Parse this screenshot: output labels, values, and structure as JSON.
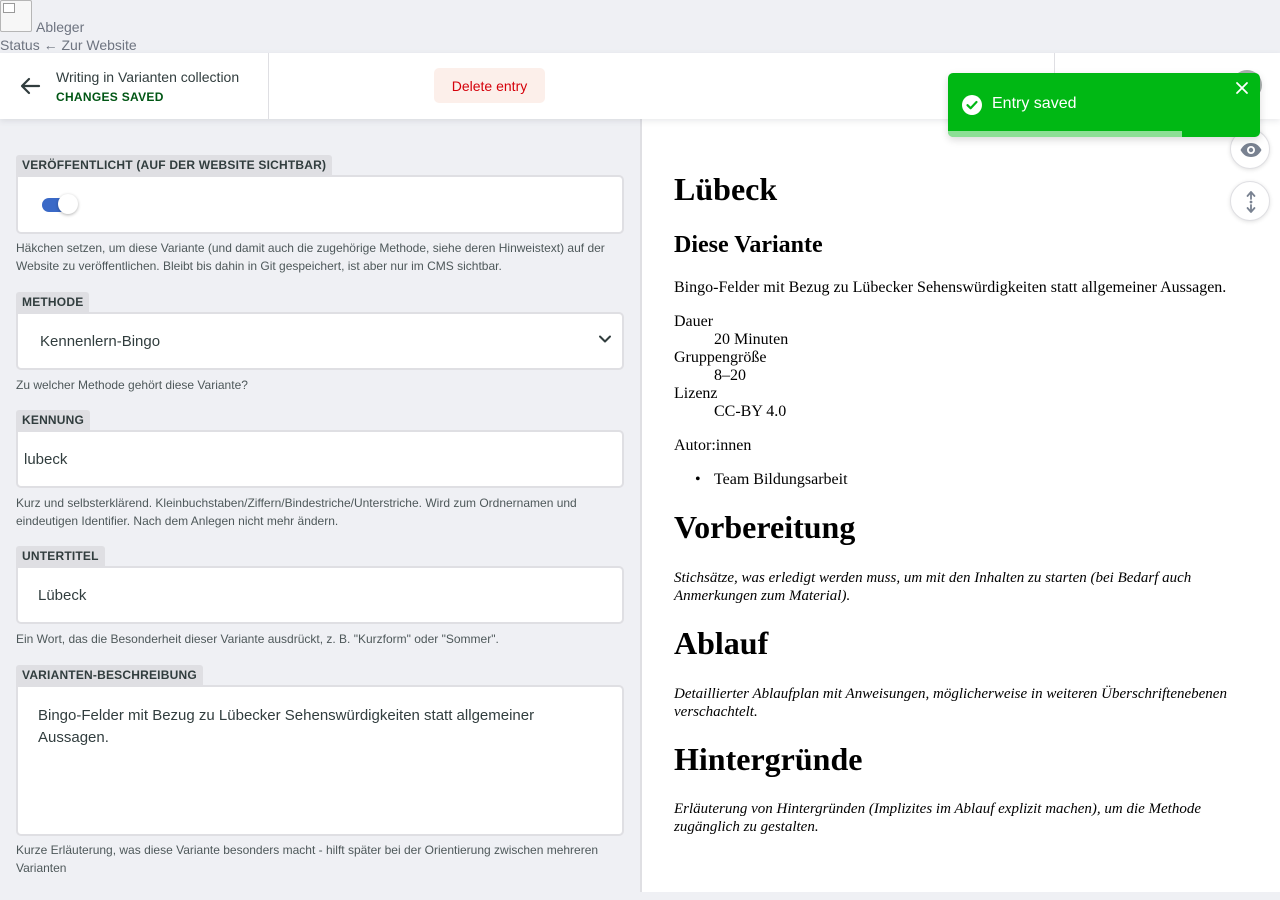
{
  "site": {
    "name": "Ableger",
    "status_label": "Status",
    "back_to_site": "← Zur Website"
  },
  "toolbar": {
    "collection_title": "Writing in Varianten collection",
    "saved_status": "CHANGES SAVED",
    "delete_label": "Delete entry"
  },
  "toast": {
    "message": "Entry saved",
    "progress": 0.75
  },
  "fields": {
    "published": {
      "label": "VERÖFFENTLICHT (AUF DER WEBSITE SICHTBAR)",
      "value": true,
      "hint": "Häkchen setzen, um diese Variante (und damit auch die zugehörige Methode, siehe deren Hinweistext) auf der Website zu veröffentlichen. Bleibt bis dahin in Git gespeichert, ist aber nur im CMS sichtbar."
    },
    "method": {
      "label": "METHODE",
      "value": "Kennenlern-Bingo",
      "hint": "Zu welcher Methode gehört diese Variante?"
    },
    "id": {
      "label": "KENNUNG",
      "value": "lubeck",
      "hint": "Kurz und selbsterklärend. Kleinbuchstaben/Ziffern/Bindestriche/Unterstriche. Wird zum Ordnernamen und eindeutigen Identifier. Nach dem Anlegen nicht mehr ändern."
    },
    "subtitle": {
      "label": "UNTERTITEL",
      "value": "Lübeck",
      "hint": "Ein Wort, das die Besonderheit dieser Variante ausdrückt, z. B. \"Kurzform\" oder \"Sommer\"."
    },
    "description": {
      "label": "VARIANTEN-BESCHREIBUNG",
      "value": "Bingo-Felder mit Bezug zu Lübecker Sehenswürdigkeiten statt allgemeiner Aussagen.",
      "hint": "Kurze Erläuterung, was diese Variante besonders macht - hilft später bei der Orientierung zwischen mehreren Varianten"
    }
  },
  "preview": {
    "title": "Lübeck",
    "variant_heading": "Diese Variante",
    "variant_text": "Bingo-Felder mit Bezug zu Lübecker Sehenswürdigkeiten statt allgemeiner Aussagen.",
    "meta": [
      {
        "term": "Dauer",
        "value": "20 Minuten"
      },
      {
        "term": "Gruppengröße",
        "value": "8–20"
      },
      {
        "term": "Lizenz",
        "value": "CC-BY 4.0"
      }
    ],
    "authors_label": "Autor:innen",
    "authors": [
      "Team Bildungsarbeit"
    ],
    "sections": [
      {
        "heading": "Vorbereitung",
        "text": "Stichsätze, was erledigt werden muss, um mit den Inhalten zu starten (bei Bedarf auch Anmerkungen zum Material)."
      },
      {
        "heading": "Ablauf",
        "text": "Detaillierter Ablaufplan mit Anweisungen, möglicherweise in weiteren Überschriftenebenen verschachtelt."
      },
      {
        "heading": "Hintergründe",
        "text": "Erläuterung von Hintergründen (Implizites im Ablauf explizit machen), um die Methode zugänglich zu gestalten."
      }
    ]
  },
  "colors": {
    "accent": "#3a69c7",
    "success": "#00b814",
    "danger": "#d5000a",
    "saved": "#005614"
  },
  "icons": [
    "back-arrow-icon",
    "check-circle-icon",
    "close-icon",
    "chevron-down-icon",
    "eye-icon",
    "sync-scroll-icon"
  ]
}
